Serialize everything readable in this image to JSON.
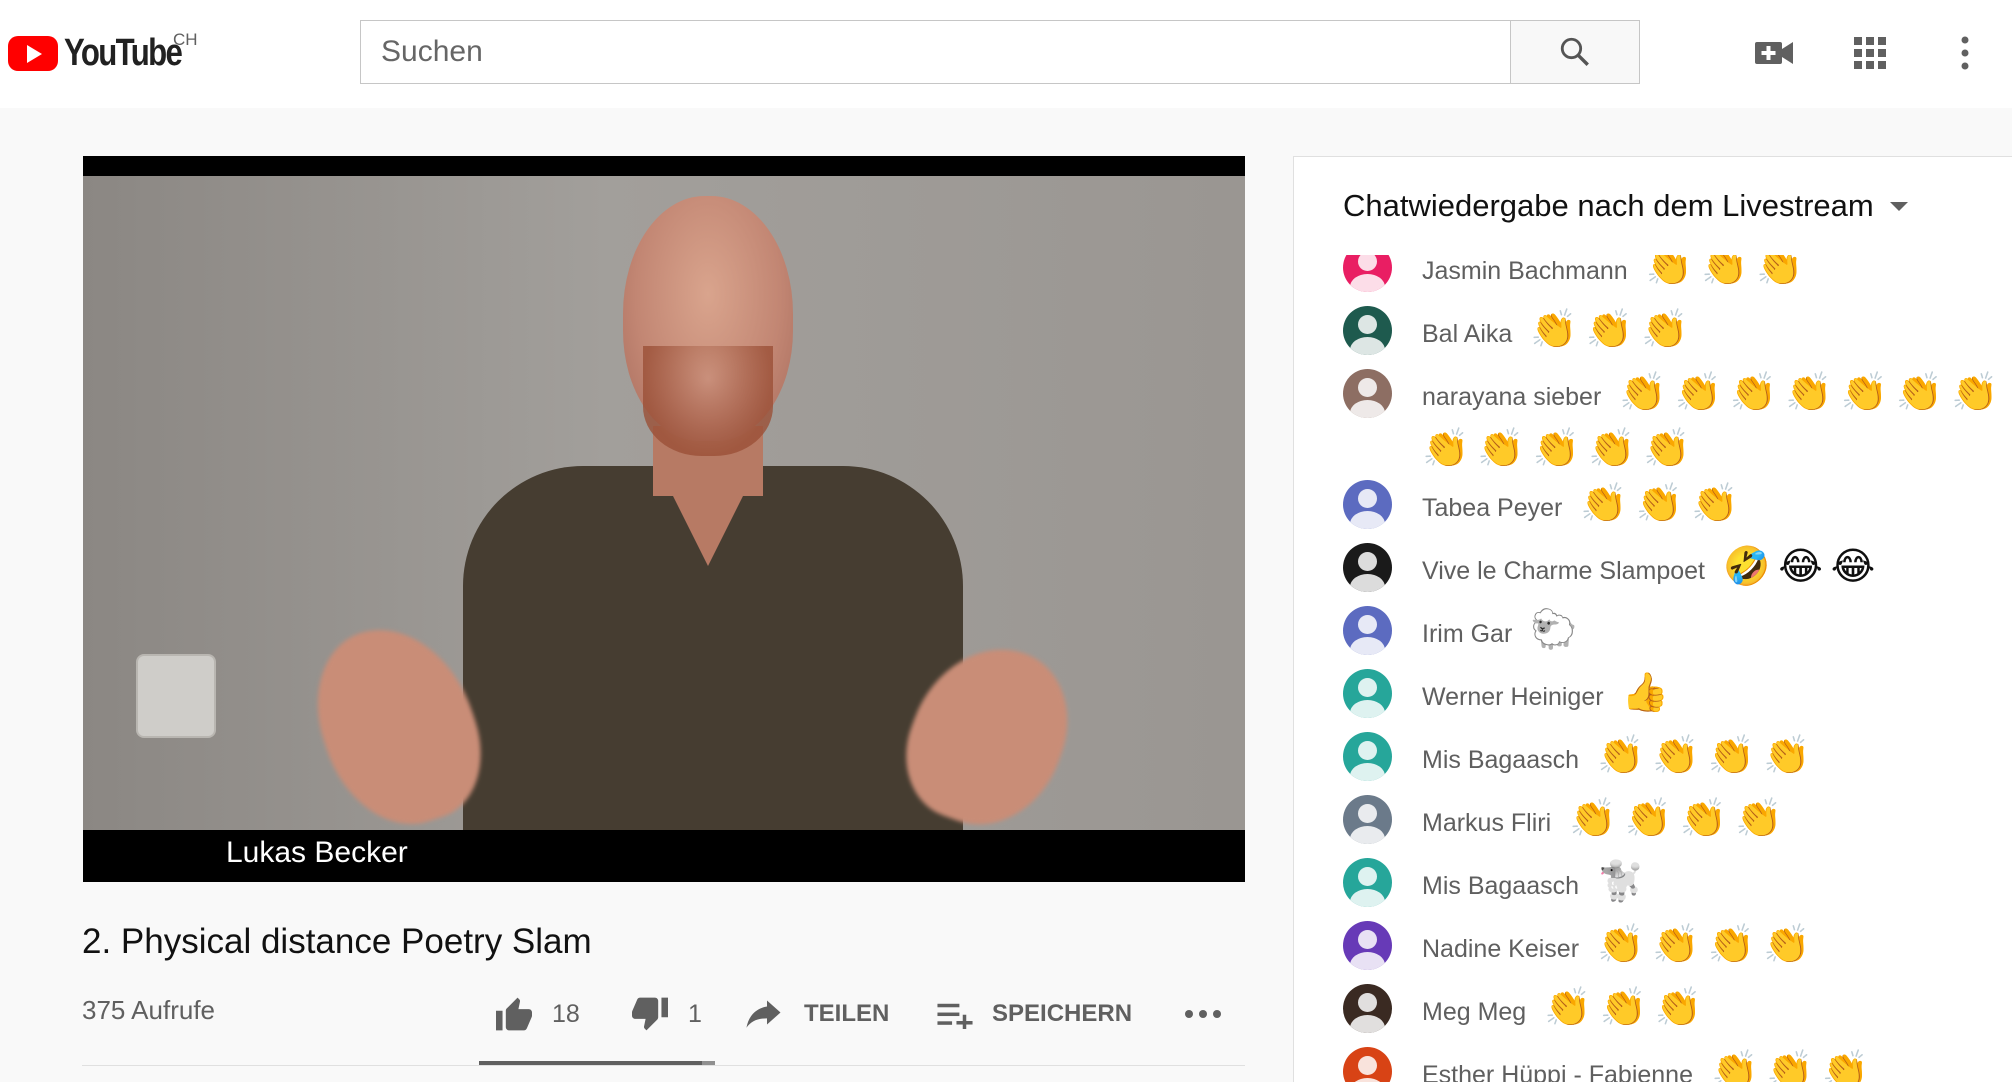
{
  "header": {
    "logo_text": "YouTube",
    "region": "CH",
    "search_placeholder": "Suchen",
    "icons": [
      "search-icon",
      "video-camera-add-icon",
      "apps-grid-icon",
      "more-vert-icon"
    ]
  },
  "video": {
    "caption": "Lukas Becker",
    "title": "2. Physical distance Poetry Slam",
    "views": "375 Aufrufe",
    "like_count": "18",
    "dislike_count": "1",
    "share_label": "TEILEN",
    "save_label": "SPEICHERN",
    "like_ratio": 0.947
  },
  "chat": {
    "header_title": "Chatwiedergabe nach dem Livestream",
    "messages": [
      {
        "author": "Jasmin Bachmann",
        "emojis": "👏👏👏",
        "avatar_color": "#e91e63"
      },
      {
        "author": "Bal Aika",
        "emojis": "👏👏👏",
        "avatar_color": "#1e5a4e"
      },
      {
        "author": "narayana sieber",
        "emojis": "👏👏👏👏👏👏👏👏👏👏👏👏",
        "avatar_color": "#8d6e63"
      },
      {
        "author": "Tabea Peyer",
        "emojis": "👏👏👏",
        "avatar_color": "#5c6bc0"
      },
      {
        "author": "Vive le Charme Slampoet",
        "emojis": "🤣😂😂",
        "avatar_color": "#1a1a1a"
      },
      {
        "author": "Irim Gar",
        "emojis": "🐑",
        "avatar_color": "#5c6bc0"
      },
      {
        "author": "Werner Heiniger",
        "emojis": "👍",
        "avatar_color": "#26a69a"
      },
      {
        "author": "Mis Bagaasch",
        "emojis": "👏👏👏👏",
        "avatar_color": "#26a69a"
      },
      {
        "author": "Markus Fliri",
        "emojis": "👏👏👏👏",
        "avatar_color": "#6b7a8a"
      },
      {
        "author": "Mis Bagaasch",
        "emojis": "🐩",
        "avatar_color": "#26a69a"
      },
      {
        "author": "Nadine Keiser",
        "emojis": "👏👏👏👏",
        "avatar_color": "#673ab7"
      },
      {
        "author": "Meg Meg",
        "emojis": "👏👏👏",
        "avatar_color": "#3a2a22"
      },
      {
        "author": "Esther Hüppi - Fabienne",
        "emojis": "👏👏👏",
        "avatar_color": "#d84315"
      }
    ]
  }
}
